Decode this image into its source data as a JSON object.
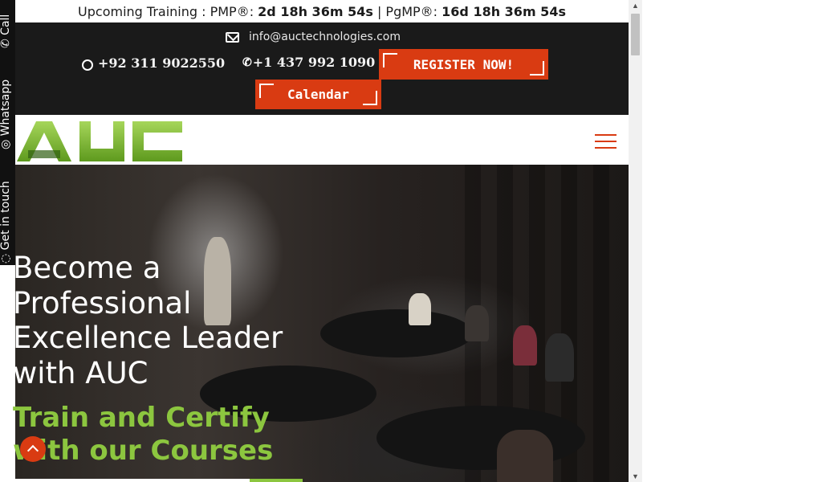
{
  "topbar": {
    "prefix": "Upcoming Training : PMP®: ",
    "pmp_countdown": "2d 18h 36m 54s",
    "separator": " | PgMP®: ",
    "pgmp_countdown": "16d 18h 36m 54s"
  },
  "contact": {
    "email": "info@auctechnologies.com",
    "phone_pk": "+92 311 9022550",
    "phone_ca": "+1 437 992 1090",
    "register_label": "REGISTER NOW!",
    "calendar_label": "Calendar"
  },
  "logo": {
    "text": "AUC",
    "color": "#8cc63f"
  },
  "hero": {
    "title_lines": [
      "Become a",
      "Professional",
      "Excellence Leader",
      "with AUC"
    ],
    "subtitle_lines": [
      "Train and Certify",
      "with our Courses"
    ]
  },
  "sidebar": {
    "call": "Call",
    "whatsapp": "Whatsapp",
    "get_in_touch": "Get in touch"
  },
  "colors": {
    "accent": "#d93b12",
    "brand_green": "#8cc63f",
    "bar": "#1a1a1a"
  },
  "icons": {
    "email": "mail-icon",
    "whatsapp": "whatsapp-icon",
    "phone": "phone-icon",
    "menu": "hamburger-menu-icon",
    "scroll_top": "chevron-up-icon"
  }
}
